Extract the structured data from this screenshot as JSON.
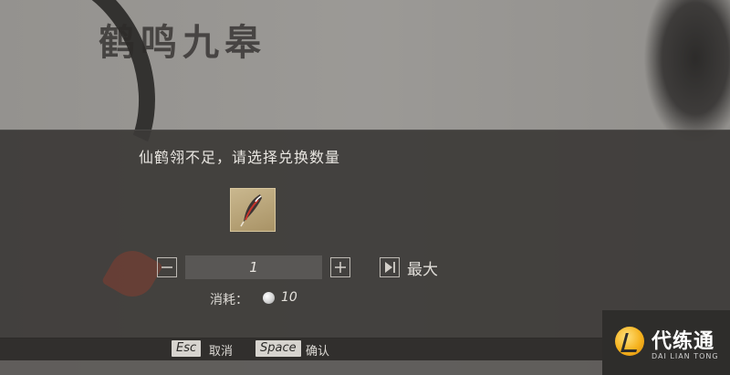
{
  "background": {
    "title": "鹤鸣九皋"
  },
  "dialog": {
    "prompt": "仙鹤翎不足，请选择兑换数量",
    "item": {
      "icon": "feather-icon"
    },
    "quantity": {
      "value": "1",
      "decrement_icon": "minus-icon",
      "increment_icon": "plus-icon",
      "max_icon": "skip-to-end-icon",
      "max_label": "最大"
    },
    "cost": {
      "label": "消耗：",
      "currency_icon": "pearl-coin-icon",
      "value": "10"
    }
  },
  "hints": {
    "cancel_key": "Esc",
    "cancel_label": "取消",
    "confirm_key": "Space",
    "confirm_label": "确认"
  },
  "watermark": {
    "text": "代练通",
    "subtext": "DAI LIAN TONG"
  },
  "colors": {
    "dialog_bg": "#3c3a38",
    "text": "#e9e6e1",
    "key_bg": "#d7d4cf",
    "logo_accent": "#f5b21e"
  }
}
